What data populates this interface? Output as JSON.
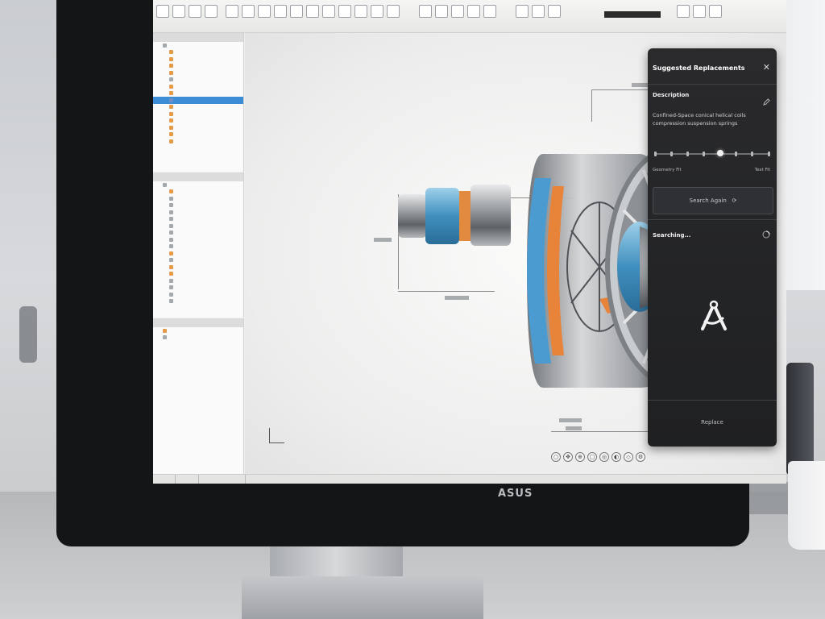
{
  "monitor": {
    "brand": "ASUS"
  },
  "suggestions_panel": {
    "title": "Suggested Replacements",
    "close_icon": "close-icon",
    "description_label": "Description",
    "description_text": "Confined-Space conical helical coils compression suspension springs",
    "slider_left_label": "Geometry Fit",
    "slider_right_label": "Text Fit",
    "search_again_label": "Search Again",
    "searching_label": "Searching...",
    "replace_label": "Replace"
  },
  "colors": {
    "panel_bg": "#242528",
    "accent_orange": "#e8833a",
    "accent_blue": "#4f9fd0",
    "selection_blue": "#3d8dd6"
  }
}
